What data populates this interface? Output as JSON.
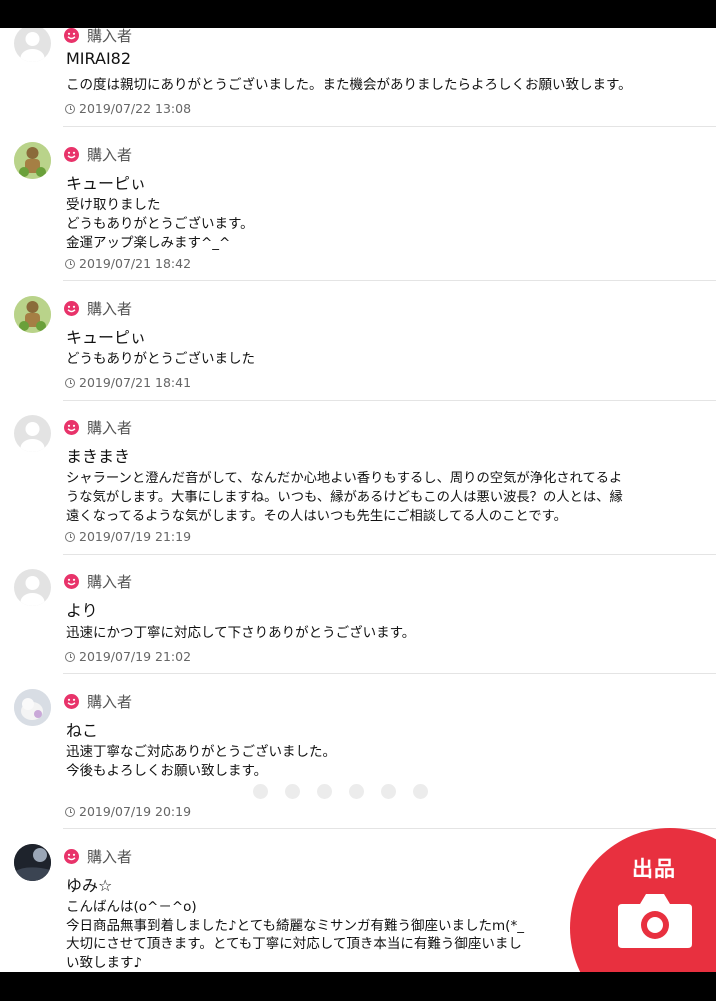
{
  "badge_label": "購入者",
  "reviews": [
    {
      "name": "MIRAI82",
      "comment": "この度は親切にありがとうございました。また機会がありましたらよろしくお願い致します。",
      "timestamp": "2019/07/22 13:08",
      "avatar": "default-avatar"
    },
    {
      "name": "キューピぃ",
      "comment": "受け取りました\nどうもありがとうございます。\n金運アップ楽しみます^_^",
      "timestamp": "2019/07/21 18:42",
      "avatar": "figure-avatar"
    },
    {
      "name": "キューピぃ",
      "comment": "どうもありがとうございました",
      "timestamp": "2019/07/21 18:41",
      "avatar": "figure-avatar"
    },
    {
      "name": "まきまき",
      "comment": "シャラーンと澄んだ音がして、なんだか心地よい香りもするし、周りの空気が浄化されてるよ\nうな気がします。大事にしますね。いつも、縁があるけどもこの人は悪い波長？の人とは、縁\n遠くなってるような気がします。その人はいつも先生にご相談してる人のことです。",
      "timestamp": "2019/07/19 21:19",
      "avatar": "default-avatar"
    },
    {
      "name": "より",
      "comment": "迅速にかつ丁寧に対応して下さりありがとうございます。",
      "timestamp": "2019/07/19 21:02",
      "avatar": "default-avatar"
    },
    {
      "name": "ねこ",
      "comment": "迅速丁寧なご対応ありがとうございました。\n今後もよろしくお願い致します。",
      "timestamp": "2019/07/19 20:19",
      "avatar": "cat-avatar"
    },
    {
      "name": "ゆみ☆",
      "comment": "こんばんは(o^－^o)\n今日商品無事到着しました♪とても綺麗なミサンガ有難う御座いましたm(*_\n大切にさせて頂きます。とても丁寧に対応して頂き本当に有難う御座いまし\nい致します♪",
      "timestamp": "",
      "avatar": "dark-avatar"
    }
  ],
  "sell_button": {
    "label": "出品",
    "icon": "camera-icon",
    "color": "#e8303f"
  },
  "colors": {
    "badge": "#e8336a",
    "text": "#111111",
    "meta": "#666666"
  }
}
